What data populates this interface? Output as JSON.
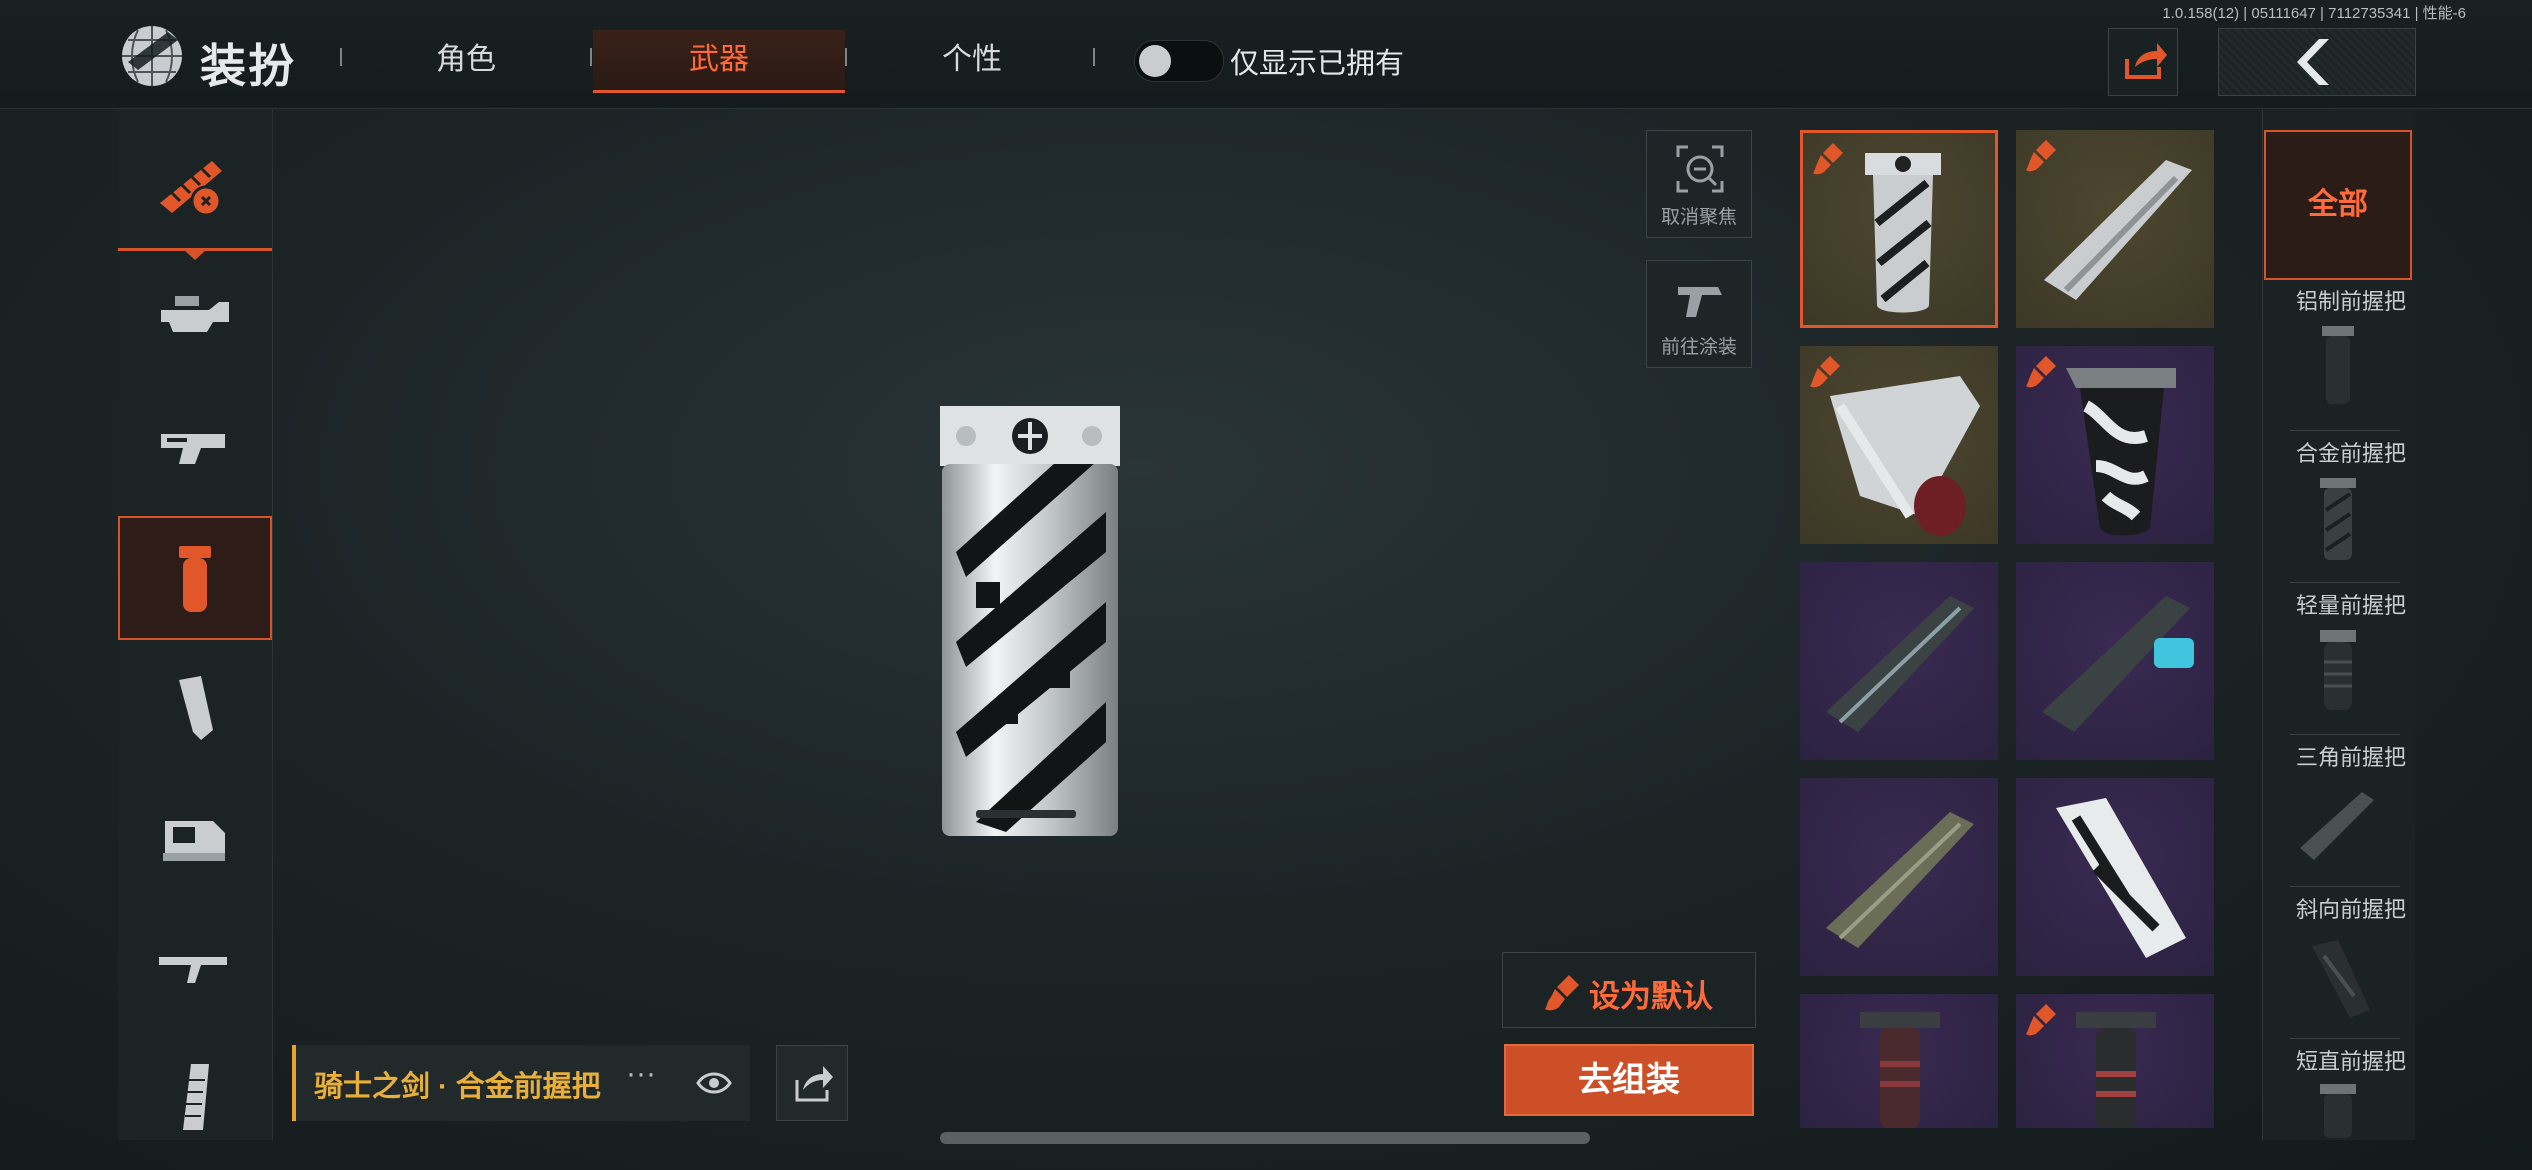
{
  "app": {
    "version": "1.0.158(12) | 05111647 | 7112735341 | 性能-6",
    "title": "装扮"
  },
  "tabs": [
    {
      "label": "角色",
      "selected": false
    },
    {
      "label": "武器",
      "selected": true
    },
    {
      "label": "个性",
      "selected": false
    }
  ],
  "toggle": {
    "label": "仅显示已拥有",
    "on": false
  },
  "left_rail": {
    "items": [
      "weapon-skin-icon",
      "receiver-icon",
      "magazine-well-icon",
      "foregrip-icon",
      "grip-icon",
      "optic-icon",
      "stock-icon",
      "magazine-icon"
    ],
    "active_index": 3
  },
  "stage_actions": {
    "unfocus_label": "取消聚焦",
    "goto_paint_label": "前往涂装"
  },
  "current_item": {
    "name": "骑士之剑 · 合金前握把",
    "more": "···"
  },
  "buttons": {
    "set_default": "设为默认",
    "assemble": "去组装"
  },
  "items": [
    {
      "rarity": "gold",
      "kind": "alloy-grip",
      "selected": true,
      "painted": true
    },
    {
      "rarity": "gold",
      "kind": "angled-grip",
      "selected": false,
      "painted": true
    },
    {
      "rarity": "gold",
      "kind": "handstop-grip",
      "selected": false,
      "painted": true
    },
    {
      "rarity": "purple",
      "kind": "camo-grip",
      "selected": false,
      "painted": true
    },
    {
      "rarity": "purple",
      "kind": "angled-grip-dark",
      "selected": false,
      "painted": false
    },
    {
      "rarity": "purple",
      "kind": "angled-grip-cyan",
      "selected": false,
      "painted": false
    },
    {
      "rarity": "purple",
      "kind": "angled-grip-olive",
      "selected": false,
      "painted": false
    },
    {
      "rarity": "purple",
      "kind": "slant-grip-white",
      "selected": false,
      "painted": false
    },
    {
      "rarity": "purple",
      "kind": "short-grip-red",
      "selected": false,
      "painted": false
    },
    {
      "rarity": "purple",
      "kind": "short-grip-red",
      "selected": false,
      "painted": true
    }
  ],
  "categories": {
    "all_label": "全部",
    "list": [
      "铝制前握把",
      "合金前握把",
      "轻量前握把",
      "三角前握把",
      "斜向前握把",
      "短直前握把"
    ]
  },
  "colors": {
    "accent": "#e2572a",
    "gold_name": "#e8b03a",
    "gold_bg": "#453f2b",
    "purple_bg": "#31264a"
  }
}
